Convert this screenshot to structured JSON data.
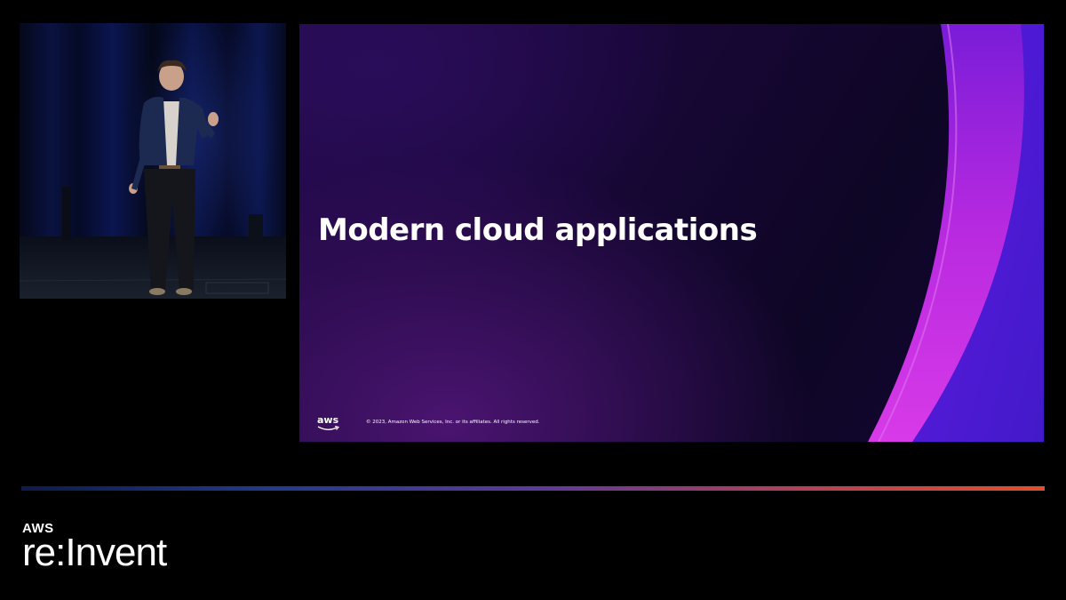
{
  "slide": {
    "title": "Modern cloud applications",
    "logo_text": "aws",
    "copyright": "© 2023, Amazon Web Services, Inc. or its affiliates. All rights reserved."
  },
  "event": {
    "aws_text": "AWS",
    "brand_prefix": "re:",
    "brand_suffix": "Invent"
  },
  "colors": {
    "slide_accent_magenta": "#c02adf",
    "slide_accent_blue": "#4a1ad8",
    "bar_start": "#0e1a4a",
    "bar_end": "#e0502c"
  },
  "icons": [
    "aws-smile-icon"
  ]
}
